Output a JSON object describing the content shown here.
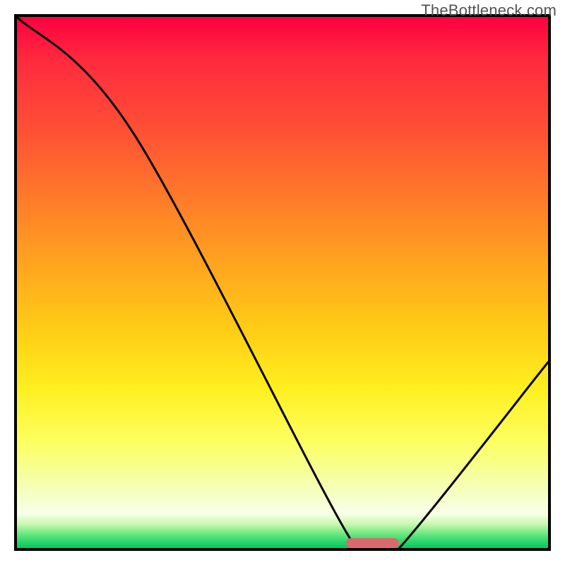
{
  "watermark": "TheBottleneck.com",
  "chart_data": {
    "type": "line",
    "title": "",
    "xlabel": "",
    "ylabel": "",
    "xlim": [
      0,
      100
    ],
    "ylim": [
      0,
      100
    ],
    "grid": false,
    "legend": false,
    "series": [
      {
        "name": "bottleneck-curve",
        "x": [
          0,
          22,
          62,
          68,
          72,
          100
        ],
        "values": [
          100,
          78,
          3,
          0,
          0,
          35
        ]
      }
    ],
    "annotations": [
      {
        "name": "optimal-marker",
        "x_start": 62,
        "x_end": 72,
        "y": 0,
        "color": "#d86a6f"
      }
    ],
    "background_gradient_stops": [
      {
        "pos": 0.0,
        "color": "#ff0040"
      },
      {
        "pos": 0.46,
        "color": "#ffa31f"
      },
      {
        "pos": 0.7,
        "color": "#ffef20"
      },
      {
        "pos": 0.94,
        "color": "#f8ffe8"
      },
      {
        "pos": 1.0,
        "color": "#00c860"
      }
    ]
  },
  "colors": {
    "line": "#000000",
    "frame": "#000000",
    "marker": "#d86a6f",
    "watermark": "#525252"
  }
}
